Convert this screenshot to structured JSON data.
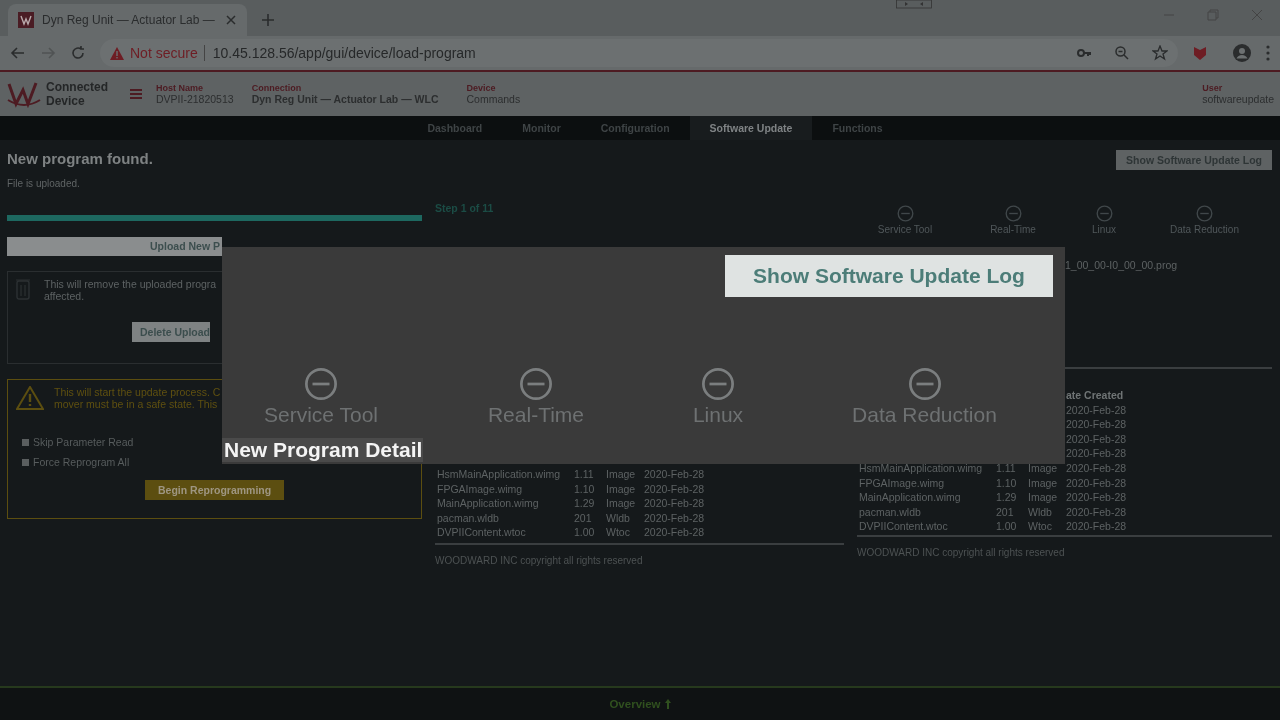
{
  "browser": {
    "tab_title": "Dyn Reg Unit — Actuator Lab —",
    "security": "Not secure",
    "url": "10.45.128.56/app/gui/device/load-program"
  },
  "header": {
    "brand": "Connected Device",
    "fields": [
      {
        "label": "Host Name",
        "value": "DVPII-21820513"
      },
      {
        "label": "Connection",
        "value": "Dyn Reg Unit — Actuator Lab — WLC"
      },
      {
        "label": "Device",
        "value": "Commands"
      }
    ],
    "user": {
      "label": "User",
      "value": "softwareupdate"
    }
  },
  "nav": [
    {
      "label": "Dashboard",
      "selected": false
    },
    {
      "label": "Monitor",
      "selected": false
    },
    {
      "label": "Configuration",
      "selected": false
    },
    {
      "label": "Software Update",
      "selected": true
    },
    {
      "label": "Functions",
      "selected": false
    }
  ],
  "left": {
    "title": "New program found.",
    "subtitle": "File is uploaded.",
    "progress": {
      "level": 1
    },
    "upload_button": "Upload New P",
    "delete_notice": [
      "This will remove the uploaded progra",
      "affected."
    ],
    "delete_button": "Delete Upload",
    "warning": [
      "This will start the update process. C",
      "mover must be in a safe state. This"
    ],
    "options": [
      {
        "label": "Skip Parameter Read",
        "checked": false
      },
      {
        "label": "Force Reprogram All",
        "checked": false
      }
    ],
    "begin_button": "Begin Reprogramming"
  },
  "middle": {
    "step": "Step 1 of 11",
    "rows": [
      {
        "name": "HsmMainApplication.wimg",
        "version": "1.11",
        "type": "Image",
        "date": "2020-Feb-28"
      },
      {
        "name": "FPGAImage.wimg",
        "version": "1.10",
        "type": "Image",
        "date": "2020-Feb-28"
      },
      {
        "name": "MainApplication.wimg",
        "version": "1.29",
        "type": "Image",
        "date": "2020-Feb-28"
      },
      {
        "name": "pacman.wldb",
        "version": "201",
        "type": "Wldb",
        "date": "2020-Feb-28"
      },
      {
        "name": "DVPIIContent.wtoc",
        "version": "1.00",
        "type": "Wtoc",
        "date": "2020-Feb-28"
      }
    ],
    "copyright": "WOODWARD INC copyright all rights reserved"
  },
  "right": {
    "log_button": "Show Software Update Log",
    "steps": [
      "Service Tool",
      "Real-Time",
      "Linux",
      "Data Reduction"
    ],
    "file": "1_00_00-I0_00_00.prog",
    "date_header": "ate Created",
    "rows": [
      {
        "date": "2020-Feb-28"
      },
      {
        "date": "2020-Feb-28"
      },
      {
        "date": "2020-Feb-28"
      },
      {
        "date": "2020-Feb-28"
      },
      {
        "name": "HsmMainApplication.wimg",
        "version": "1.11",
        "type": "Image",
        "date": "2020-Feb-28"
      },
      {
        "name": "FPGAImage.wimg",
        "version": "1.10",
        "type": "Image",
        "date": "2020-Feb-28"
      },
      {
        "name": "MainApplication.wimg",
        "version": "1.29",
        "type": "Image",
        "date": "2020-Feb-28"
      },
      {
        "name": "pacman.wldb",
        "version": "201",
        "type": "Wldb",
        "date": "2020-Feb-28"
      },
      {
        "name": "DVPIIContent.wtoc",
        "version": "1.00",
        "type": "Wtoc",
        "date": "2020-Feb-28"
      }
    ],
    "copyright": "WOODWARD INC copyright all rights reserved"
  },
  "zoom": {
    "button": "Show Software Update Log",
    "steps": [
      "Service Tool",
      "Real-Time",
      "Linux",
      "Data Reduction"
    ],
    "label": "New Program Detail"
  },
  "footer": {
    "label": "Overview"
  }
}
